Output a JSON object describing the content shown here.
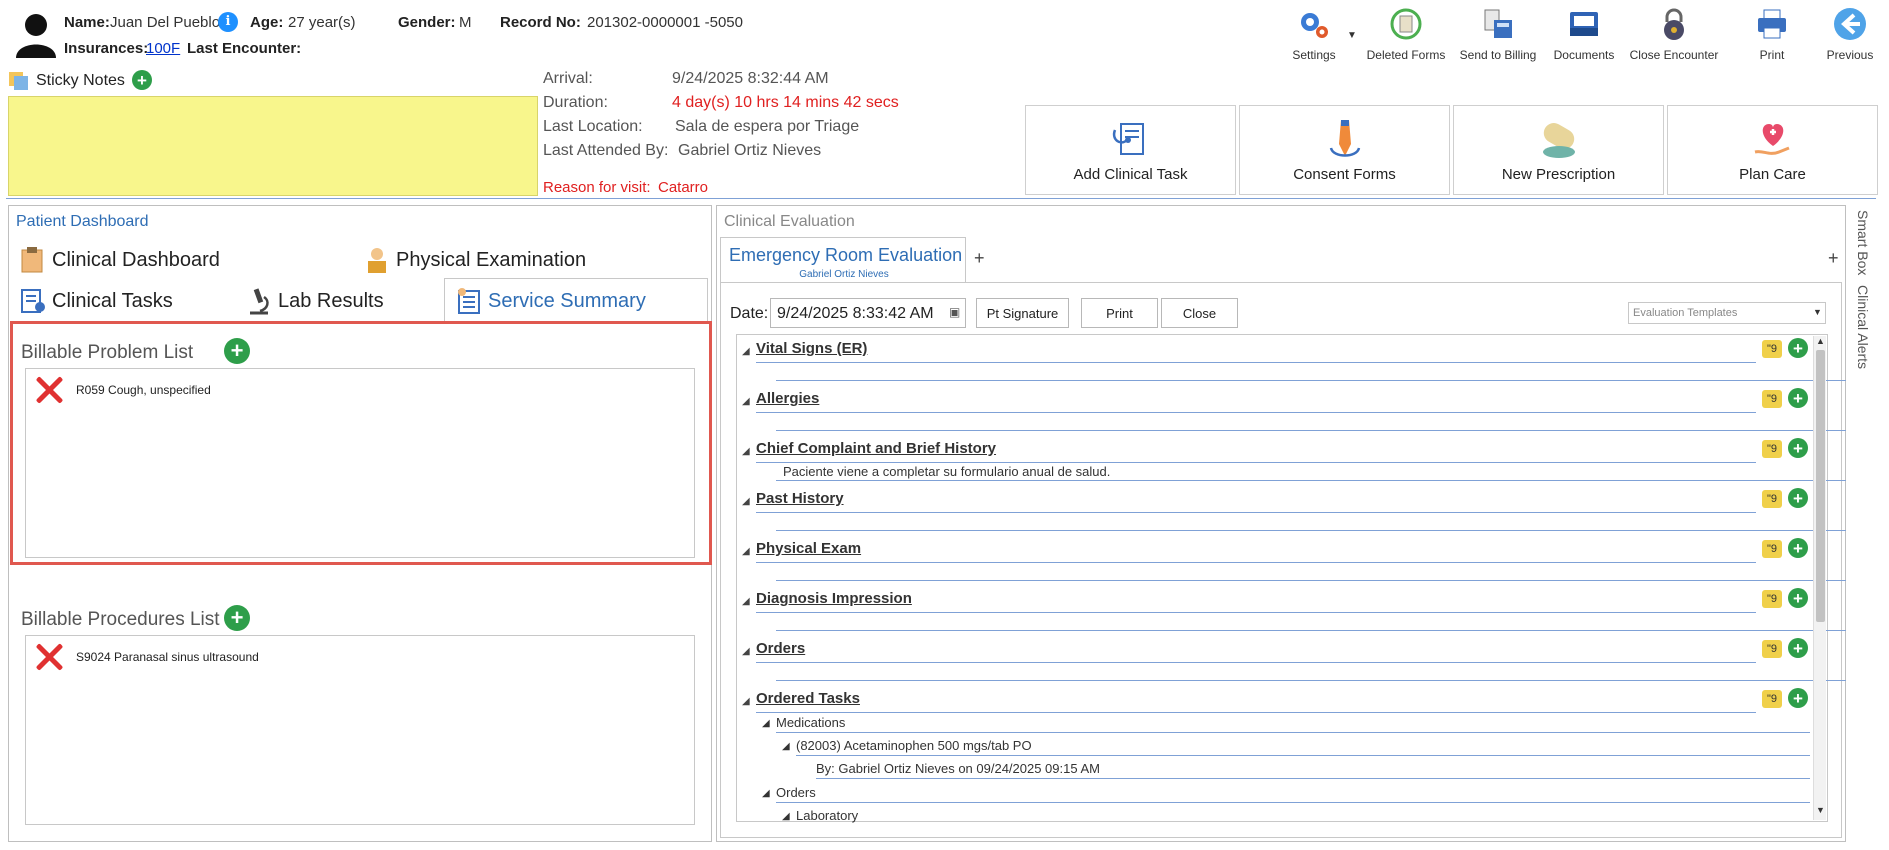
{
  "header": {
    "name_label": "Name:",
    "name_value": "Juan Del Pueblo",
    "age_label": "Age:",
    "age_value": "27 year(s)",
    "gender_label": "Gender:",
    "gender_value": "M",
    "record_label": "Record No:",
    "record_value": "201302-0000001 -5050",
    "insurances_label": "Insurances:",
    "insurances_value": "100F",
    "last_encounter_label": "Last Encounter:",
    "last_encounter_value": ""
  },
  "toolbar": {
    "settings": "Settings",
    "deleted_forms": "Deleted Forms",
    "send_to_billing": "Send to Billing",
    "documents": "Documents",
    "close_encounter": "Close Encounter",
    "print": "Print",
    "previous": "Previous"
  },
  "sticky": {
    "title": "Sticky Notes"
  },
  "visit": {
    "arrival_label": "Arrival:",
    "arrival_value": "9/24/2025 8:32:44 AM",
    "duration_label": "Duration:",
    "duration_value": "4 day(s) 10 hrs 14 mins 42 secs",
    "last_location_label": "Last Location:",
    "last_location_value": "Sala de espera por Triage",
    "last_attended_label": "Last Attended By:",
    "last_attended_value": "Gabriel Ortiz Nieves",
    "reason_label": "Reason for visit:",
    "reason_value": "Catarro"
  },
  "actions": {
    "add_clinical_task": "Add Clinical Task",
    "consent_forms": "Consent Forms",
    "new_prescription": "New Prescription",
    "plan_care": "Plan Care"
  },
  "dashboard": {
    "title": "Patient Dashboard",
    "tabs": {
      "clinical_dashboard": "Clinical Dashboard",
      "physical_examination": "Physical Examination",
      "clinical_tasks": "Clinical Tasks",
      "lab_results": "Lab Results",
      "service_summary": "Service Summary"
    },
    "problems_title": "Billable Problem List",
    "problems": [
      {
        "text": "R059 Cough, unspecified"
      }
    ],
    "procedures_title": "Billable Procedures List",
    "procedures": [
      {
        "text": "S9024 Paranasal sinus ultrasound"
      }
    ]
  },
  "evaluation": {
    "title": "Clinical Evaluation",
    "tab_title": "Emergency Room Evaluation",
    "tab_subtitle": "Gabriel Ortiz Nieves",
    "tab_add": "+",
    "date_label": "Date:",
    "date_value": "9/24/2025 8:33:42 AM",
    "pt_signature": "Pt Signature",
    "print": "Print",
    "close": "Close",
    "templates_placeholder": "Evaluation Templates",
    "sections": [
      {
        "title": "Vital Signs (ER)",
        "content": ""
      },
      {
        "title": "Allergies",
        "content": ""
      },
      {
        "title": "Chief Complaint and Brief History",
        "content": "Paciente viene a completar su formulario anual de salud."
      },
      {
        "title": "Past History",
        "content": ""
      },
      {
        "title": "Physical Exam",
        "content": ""
      },
      {
        "title": "Diagnosis Impression",
        "content": ""
      },
      {
        "title": "Orders",
        "content": ""
      },
      {
        "title": "Ordered Tasks",
        "content": ""
      }
    ],
    "ordered_tasks": {
      "medications": "Medications",
      "med_item": "(82003) Acetaminophen 500 mgs/tab PO",
      "med_by": "By: Gabriel Ortiz Nieves on 09/24/2025 09:15 AM",
      "orders": "Orders",
      "laboratory": "Laboratory"
    },
    "note_glyph": "\"9"
  },
  "side_tabs": {
    "smart_box": "Smart Box",
    "clinical_alerts": "Clinical Alerts"
  },
  "colors": {
    "accent": "#2e6db4",
    "sticky": "#f8f68c",
    "alert_red": "#e02020",
    "highlight_border": "#e0584f"
  }
}
